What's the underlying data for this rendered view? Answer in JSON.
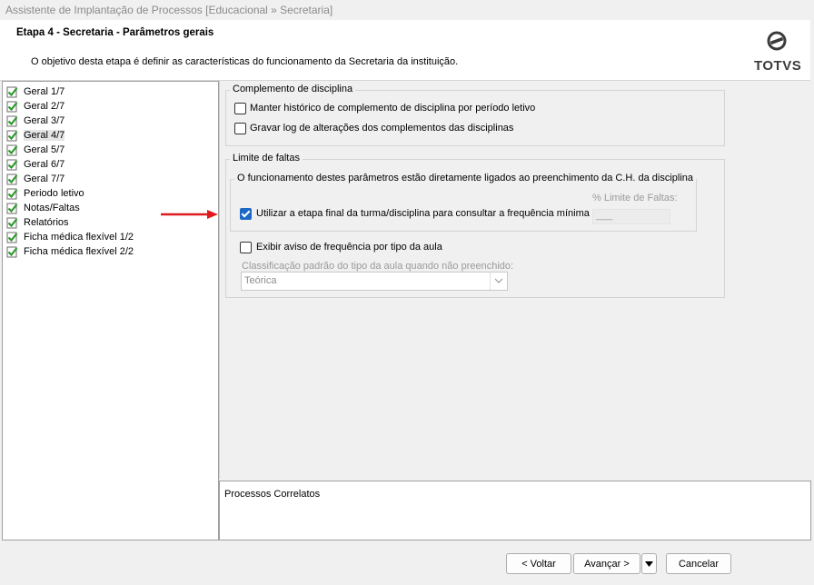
{
  "window": {
    "title": "Assistente de Implantação de Processos [Educacional » Secretaria]"
  },
  "header": {
    "step_title": "Etapa 4 - Secretaria - Parâmetros gerais",
    "description": "O objetivo desta etapa é definir as características do funcionamento da Secretaria da instituição.",
    "logo_text": "TOTVS"
  },
  "sidebar": {
    "items": [
      {
        "label": "Geral 1/7"
      },
      {
        "label": "Geral 2/7"
      },
      {
        "label": "Geral 3/7"
      },
      {
        "label": "Geral 4/7"
      },
      {
        "label": "Geral 5/7"
      },
      {
        "label": "Geral 6/7"
      },
      {
        "label": "Geral 7/7"
      },
      {
        "label": "Periodo letivo"
      },
      {
        "label": "Notas/Faltas"
      },
      {
        "label": "Relatórios"
      },
      {
        "label": "Ficha médica flexível 1/2"
      },
      {
        "label": "Ficha médica flexível 2/2"
      }
    ],
    "selected_index": 3
  },
  "complemento": {
    "title": "Complemento de disciplina",
    "opt1": "Manter histórico de complemento de disciplina por período letivo",
    "opt2": "Gravar log de alterações dos complementos das disciplinas"
  },
  "limite": {
    "title": "Limite de faltas",
    "subgroup_title": "O funcionamento destes parâmetros estão diretamente ligados ao preenchimento da C.H. da disciplina",
    "opt_etapa_final": "Utilizar a etapa final da turma/disciplina para consultar a frequência mínima",
    "opt_etapa_final_checked": true,
    "limite_label": "% Limite de Faltas:",
    "limite_value": "___",
    "opt_aviso": "Exibir aviso de frequência por tipo da aula",
    "classificacao_label": "Classificação padrão do tipo da aula quando não preenchido:",
    "classificacao_value": "Teórica"
  },
  "processos": {
    "label": "Processos Correlatos"
  },
  "buttons": {
    "back": "< Voltar",
    "next": "Avançar >",
    "cancel": "Cancelar"
  },
  "colors": {
    "accent": "#1e68c5",
    "check_green": "#2e9a2e",
    "arrow_red": "#e0191e"
  }
}
